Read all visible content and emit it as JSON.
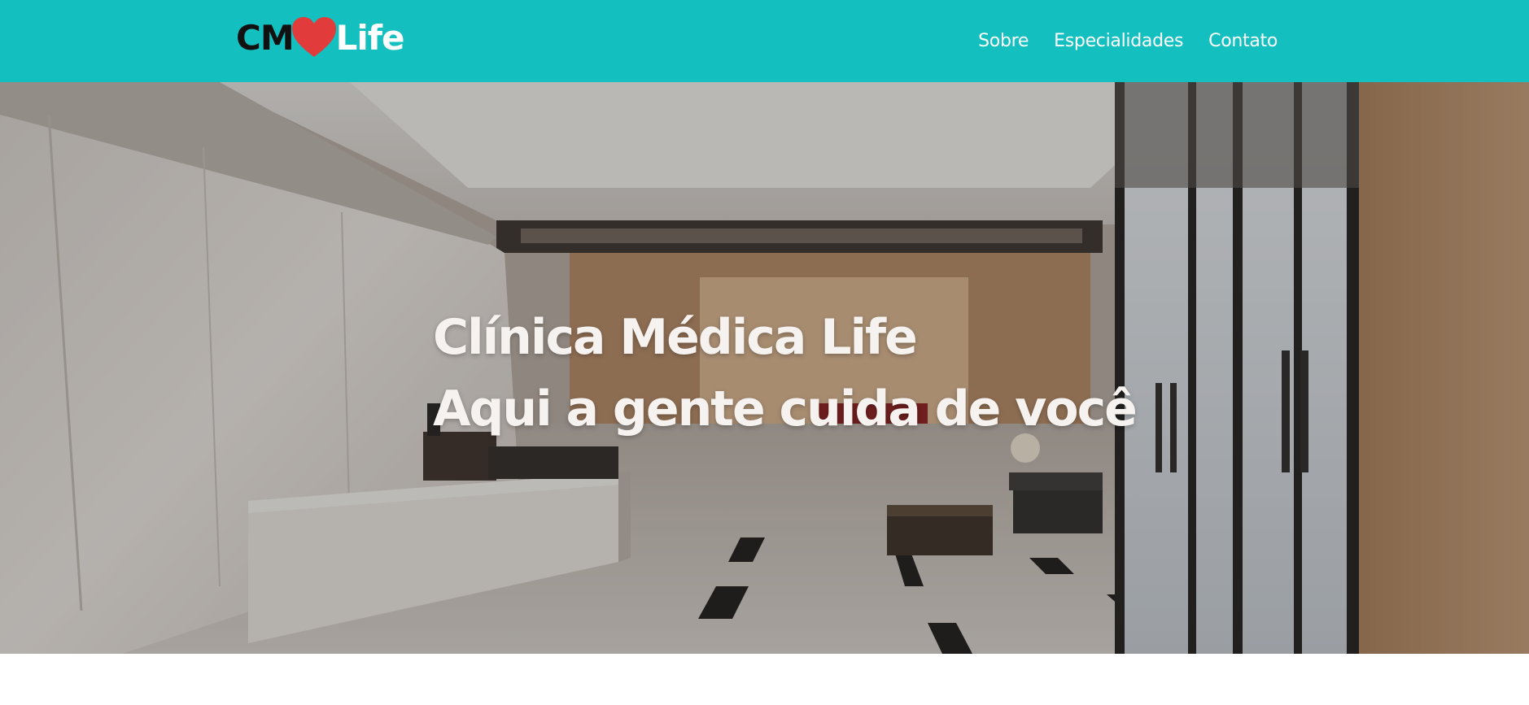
{
  "header": {
    "logo": {
      "part1": "CM",
      "part2": "Life",
      "icon": "heart-icon",
      "heart_color": "#e23b3b"
    },
    "nav": [
      {
        "label": "Sobre"
      },
      {
        "label": "Especialidades"
      },
      {
        "label": "Contato"
      }
    ],
    "background_color": "#14bfc0"
  },
  "hero": {
    "title": "Clínica Médica Life",
    "subtitle": "Aqui a gente cuida de você",
    "image": "clinic-reception-lobby"
  }
}
